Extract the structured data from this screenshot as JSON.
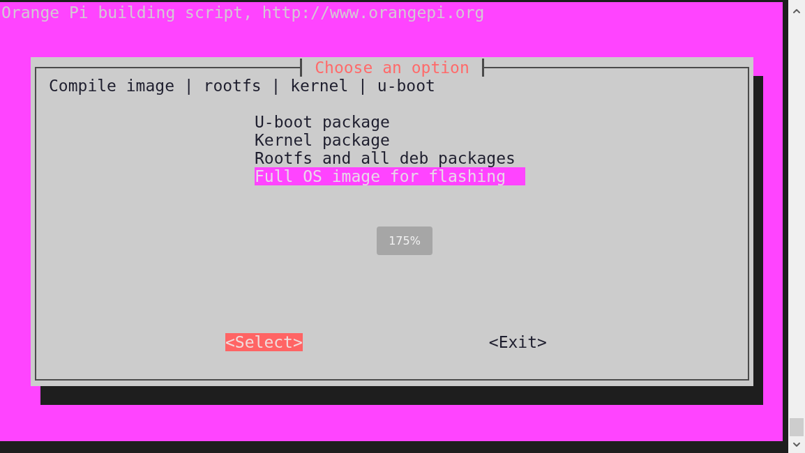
{
  "header": "Orange Pi building script, http://www.orangepi.org",
  "dialog": {
    "title": "Choose an option",
    "menu_label": "Compile image | rootfs | kernel | u-boot",
    "items": [
      {
        "label": "U-boot package",
        "selected": false
      },
      {
        "label": "Kernel package",
        "selected": false
      },
      {
        "label": "Rootfs and all deb packages",
        "selected": false
      },
      {
        "label": "Full OS image for flashing",
        "selected": true
      }
    ],
    "buttons": [
      {
        "label": "<Select>",
        "selected": true
      },
      {
        "label": "<Exit>",
        "selected": false
      }
    ]
  },
  "zoom_indicator": "175%"
}
